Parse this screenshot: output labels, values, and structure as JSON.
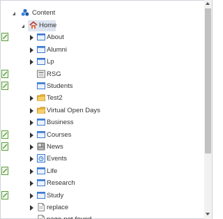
{
  "tree": {
    "root": {
      "label": "Content"
    },
    "nodes": [
      {
        "label": "Home",
        "icon": "home-icon",
        "expanded": true,
        "selected": true,
        "level": 1,
        "marker": false
      },
      {
        "label": "About",
        "icon": "folder-page-icon",
        "expandable": true,
        "level": 2,
        "marker": true
      },
      {
        "label": "Alumni",
        "icon": "folder-page-icon",
        "expandable": true,
        "level": 2,
        "marker": false
      },
      {
        "label": "Lp",
        "icon": "folder-page-icon",
        "expandable": true,
        "level": 2,
        "marker": false
      },
      {
        "label": "RSG",
        "icon": "rsg-icon",
        "expandable": false,
        "level": 2,
        "marker": true
      },
      {
        "label": "Students",
        "icon": "folder-page-icon",
        "expandable": false,
        "level": 2,
        "marker": true
      },
      {
        "label": "Test2",
        "icon": "yellow-folder-icon",
        "expandable": true,
        "level": 2,
        "marker": false
      },
      {
        "label": "Virtual Open Days",
        "icon": "yellow-folder-icon",
        "expandable": true,
        "level": 2,
        "marker": false
      },
      {
        "label": "Business",
        "icon": "folder-page-icon",
        "expandable": true,
        "level": 2,
        "marker": false
      },
      {
        "label": "Courses",
        "icon": "folder-page-icon",
        "expandable": true,
        "level": 2,
        "marker": true
      },
      {
        "label": "News",
        "icon": "news-icon",
        "expandable": true,
        "level": 2,
        "marker": true
      },
      {
        "label": "Events",
        "icon": "events-icon",
        "expandable": true,
        "level": 2,
        "marker": false
      },
      {
        "label": "Life",
        "icon": "folder-page-icon",
        "expandable": true,
        "level": 2,
        "marker": true
      },
      {
        "label": "Research",
        "icon": "folder-page-icon",
        "expandable": true,
        "level": 2,
        "marker": false
      },
      {
        "label": "Study",
        "icon": "folder-page-icon",
        "expandable": true,
        "level": 2,
        "marker": true
      },
      {
        "label": "replace",
        "icon": "document-icon",
        "expandable": true,
        "level": 2,
        "marker": false
      },
      {
        "label": "page-not-found",
        "icon": "document-icon",
        "expandable": false,
        "level": 2,
        "marker": false
      }
    ]
  },
  "colors": {
    "selection": "#dde5f0",
    "marker": "#5a9e3a",
    "folder": "#e9b43a",
    "page": "#3e7bd1"
  }
}
